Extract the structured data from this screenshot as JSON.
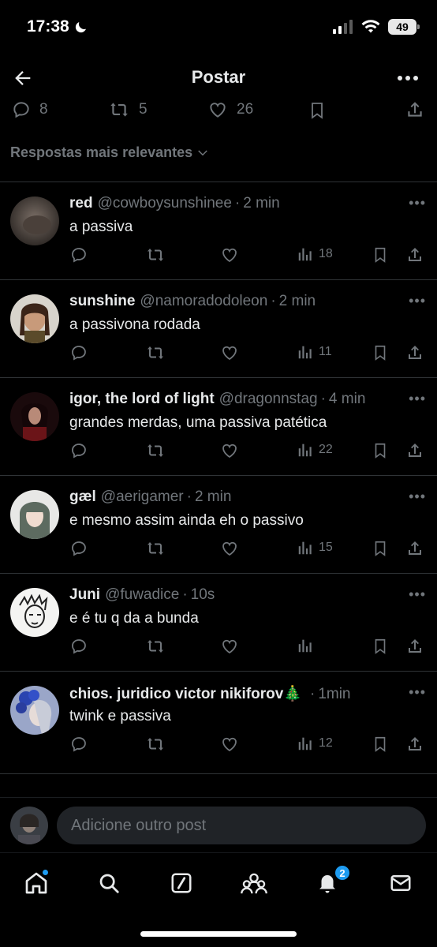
{
  "status": {
    "time": "17:38",
    "battery": "49"
  },
  "header": {
    "title": "Postar"
  },
  "stats": {
    "replies": "8",
    "reposts": "5",
    "likes": "26"
  },
  "sort": {
    "label": "Respostas mais relevantes"
  },
  "replies": [
    {
      "name": "red",
      "handle": "@cowboysunshinee",
      "time": "2 min",
      "text": "a passiva",
      "views": "18"
    },
    {
      "name": "sunshine",
      "handle": "@namoradodoleon",
      "time": "2 min",
      "text": "a passivona rodada",
      "views": "11"
    },
    {
      "name": "igor, the lord of light",
      "handle": "@dragonnstag",
      "time": "4 min",
      "text": "grandes merdas, uma passiva patética",
      "views": "22"
    },
    {
      "name": "gæl",
      "handle": "@aerigamer",
      "time": "2 min",
      "text": "e mesmo assim ainda eh o passivo",
      "views": "15"
    },
    {
      "name": "Juni",
      "handle": "@fuwadice",
      "time": "10s",
      "text": "e é tu q da a bunda",
      "views": ""
    },
    {
      "name": "chios. juridico victor nikiforov🎄",
      "handle": "",
      "time": "1min",
      "text": "twink e passiva",
      "views": "12"
    }
  ],
  "compose": {
    "placeholder": "Adicione outro post"
  },
  "tabbar": {
    "notifications_badge": "2"
  },
  "colors": {
    "background": "#000000",
    "text": "#e7e9ea",
    "muted": "#71767b",
    "accent": "#1d9bf0",
    "divider": "#2f3336"
  }
}
